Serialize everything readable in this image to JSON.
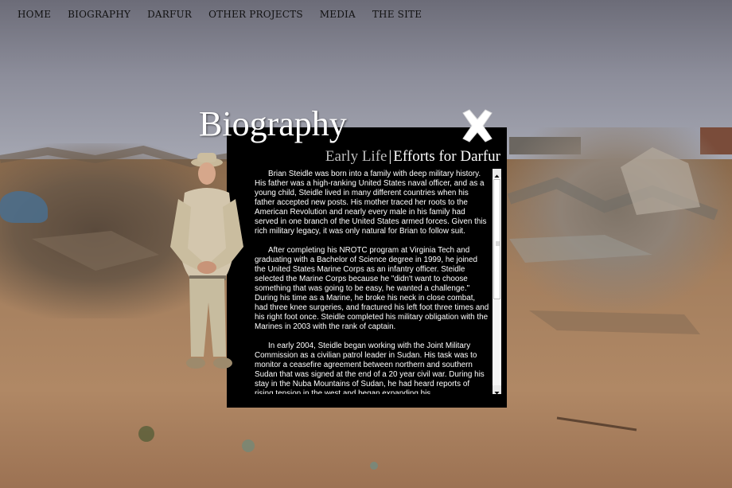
{
  "nav": {
    "items": [
      {
        "label": "HOME"
      },
      {
        "label": "BIOGRAPHY"
      },
      {
        "label": "DARFUR"
      },
      {
        "label": "OTHER PROJECTS"
      },
      {
        "label": "MEDIA"
      },
      {
        "label": "THE SITE"
      }
    ]
  },
  "page": {
    "title": "Biography"
  },
  "panel": {
    "tab_early": "Early Life",
    "separator": "|",
    "tab_efforts": "Efforts for Darfur",
    "paragraphs": [
      "Brian Steidle was born into a family with deep military history. His father was a high-ranking United States naval officer, and as a young child, Steidle lived in many different countries when his father accepted new posts. His mother traced her roots to the American Revolution and nearly every male in his family had served in one branch of the United States armed forces. Given this rich military legacy, it was only natural for Brian to follow suit.",
      "After completing his NROTC program at Virginia Tech and graduating with a Bachelor of Science degree in 1999, he joined the United States Marine Corps as an infantry officer. Steidle selected the Marine Corps because he \"didn't want to choose something that was going to be easy, he wanted a challenge.\" During his time as a Marine, he broke his neck in close combat, had three knee surgeries, and fractured his left foot three times and his right foot once. Steidle completed his military obligation with the Marines in 2003 with the rank of captain.",
      "In early 2004, Steidle began working with the Joint Military Commission as a civilian patrol leader in Sudan. His task was to monitor a ceasefire agreement between northern and southern Sudan that was signed at the end of a 20 year civil war. During his stay in the Nuba Mountains of Sudan, he had heard reports of rising tension in the west and began expanding his"
    ]
  }
}
